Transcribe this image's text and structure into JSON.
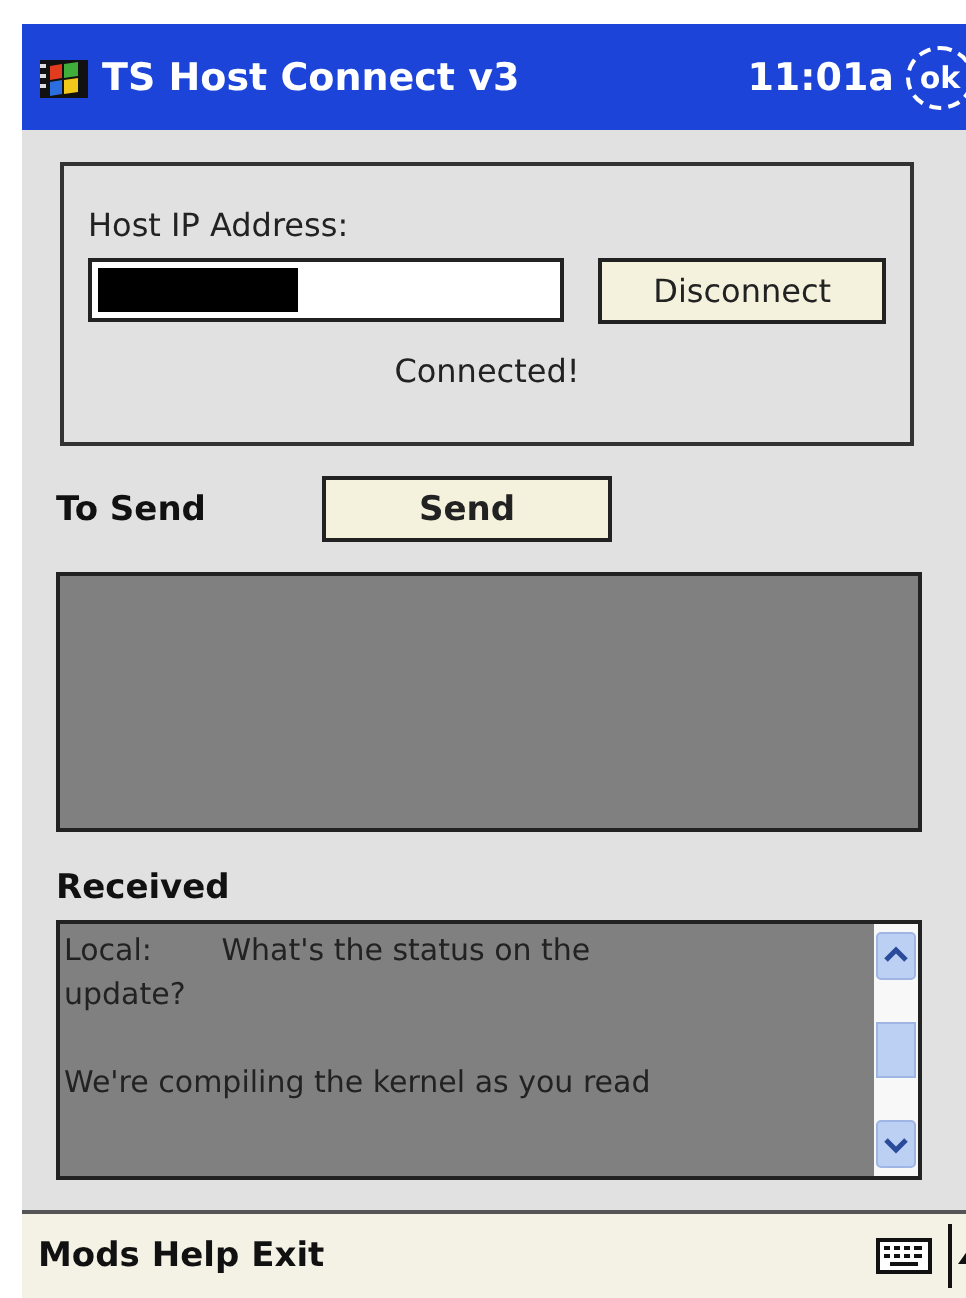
{
  "title_bar": {
    "title": "TS Host Connect v3",
    "time": "11:01a",
    "ok_button": "ok"
  },
  "connection": {
    "label": "Host IP Address:",
    "ip_field": {
      "redacted": true
    },
    "button": "Disconnect",
    "status": "Connected!"
  },
  "send": {
    "label": "To Send",
    "button": "Send"
  },
  "received": {
    "label": "Received",
    "messages": [
      {
        "sender": "Local:",
        "text": "What's the status on the update?"
      },
      {
        "text": "We're compiling the kernel as you read"
      }
    ]
  },
  "menu_bar": {
    "items": [
      "Mods",
      "Help",
      "Exit"
    ]
  }
}
